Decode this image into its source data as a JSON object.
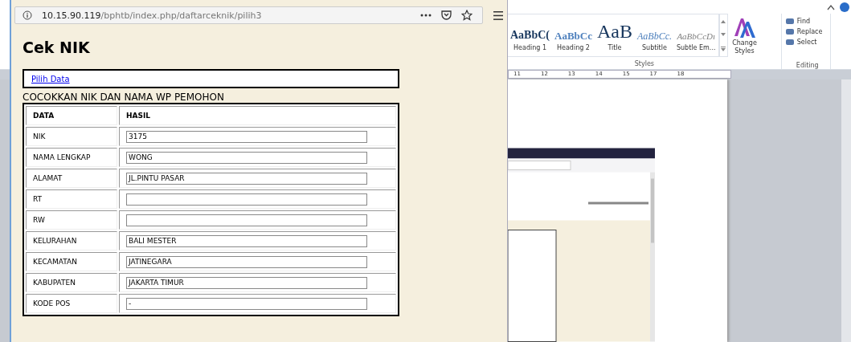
{
  "browser_popup": {
    "url_host": "10.15.90.119",
    "url_path": "/bphtb/index.php/daftarceknik/pilih3",
    "page_title": "Cek NIK",
    "link": "Pilih Data",
    "section_title": "COCOKKAN NIK DAN NAMA WP PEMOHON",
    "table": {
      "columns": [
        "DATA",
        "HASIL"
      ],
      "rows": [
        {
          "label": "NIK",
          "value": "3175"
        },
        {
          "label": "NAMA LENGKAP",
          "value": "WONG"
        },
        {
          "label": "ALAMAT",
          "value": "JL.PINTU PASAR"
        },
        {
          "label": "RT"
        },
        {
          "label": "RW"
        },
        {
          "label": "KELURAHAN",
          "value": "BALI MESTER"
        },
        {
          "label": "KECAMATAN",
          "value": "JATINEGARA"
        },
        {
          "label": "KABUPATEN",
          "value": "JAKARTA TIMUR"
        },
        {
          "label": "KODE POS",
          "value": "-"
        }
      ]
    }
  },
  "word": {
    "styles": [
      {
        "preview": "AaBbC(",
        "name": "Heading 1",
        "kind": "heading1"
      },
      {
        "preview": "AaBbCc",
        "name": "Heading 2",
        "kind": "heading2"
      },
      {
        "preview": "AaB",
        "name": "Title",
        "kind": "title"
      },
      {
        "preview": "AaBbCc.",
        "name": "Subtitle",
        "kind": "subtitle"
      },
      {
        "preview": "AaBbCcDı",
        "name": "Subtle Em...",
        "kind": "emphasis"
      }
    ],
    "styles_group": "Styles",
    "change_styles": "Change Styles",
    "editing": [
      "Find",
      "Replace",
      "Select"
    ],
    "editing_group": "Editing",
    "ruler": [
      "11",
      "12",
      "13",
      "14",
      "15",
      "17",
      "18"
    ]
  }
}
